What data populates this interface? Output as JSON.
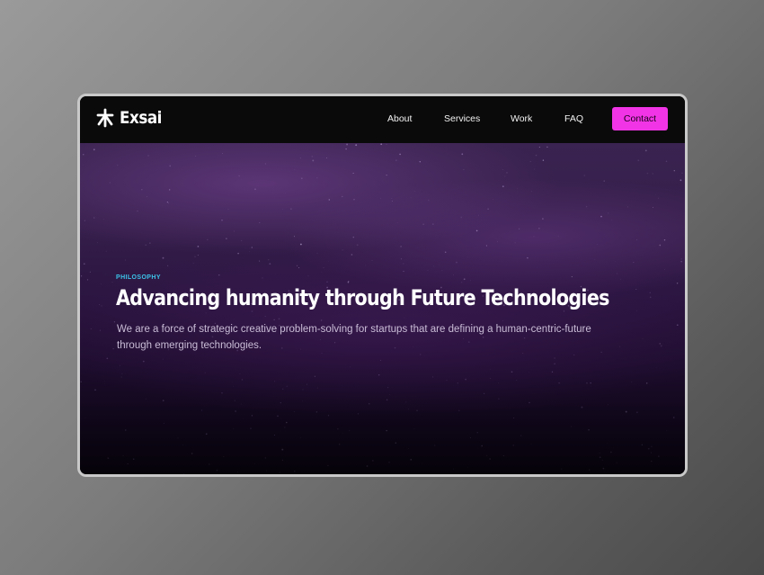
{
  "brand": {
    "name": "Exsai",
    "icon": "asterisk-logo-icon"
  },
  "nav": {
    "links": [
      {
        "label": "About"
      },
      {
        "label": "Services"
      },
      {
        "label": "Work"
      },
      {
        "label": "FAQ"
      }
    ],
    "contact_label": "Contact"
  },
  "hero": {
    "eyebrow": "PHILOSOPHY",
    "title": "Advancing humanity through Future Technologies",
    "description": "We are a force of strategic creative problem-solving for startups that are defining a human-centric-future through emerging technologies."
  },
  "colors": {
    "accent": "#f134e6",
    "eyebrow": "#3cc3e8",
    "nav_bg": "#0a0a0a",
    "hero_top": "#3a2350",
    "hero_bottom": "#050208"
  }
}
